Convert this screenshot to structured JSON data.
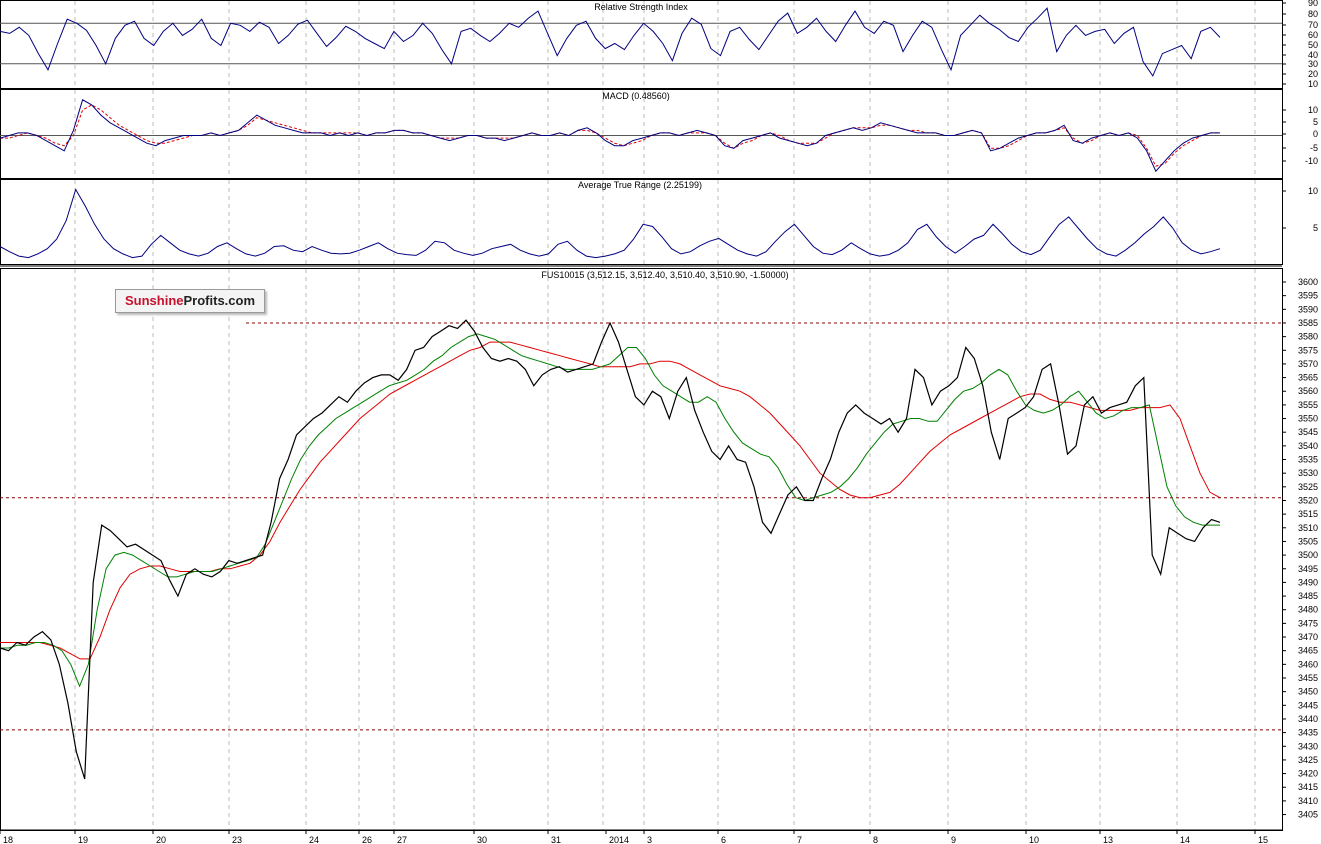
{
  "logo": {
    "part1": "Sunshine",
    "part2": "Profits.com"
  },
  "colors": {
    "price": "#000000",
    "ma_fast": "#008000",
    "ma_slow": "#e00000",
    "rsi": "#000080",
    "macd_line": "#000080",
    "macd_signal": "#e00000",
    "atr": "#000080",
    "level": "#8b0000"
  },
  "chart_data": [
    {
      "type": "line",
      "title": "Relative Strength Index",
      "ylim": [
        10,
        90
      ],
      "yticks": [
        "90",
        "80",
        "70",
        "60",
        "50",
        "40",
        "30",
        "20",
        "10"
      ],
      "reference_lines": [
        70,
        30
      ],
      "series": [
        {
          "values": [
            62,
            60,
            66,
            58,
            40,
            24,
            50,
            74,
            70,
            63,
            48,
            30,
            55,
            68,
            72,
            55,
            48,
            62,
            70,
            58,
            64,
            74,
            55,
            48,
            70,
            68,
            62,
            71,
            66,
            50,
            58,
            69,
            73,
            60,
            47,
            56,
            67,
            62,
            55,
            50,
            45,
            62,
            52,
            58,
            70,
            60,
            44,
            30,
            62,
            65,
            58,
            52,
            60,
            70,
            66,
            75,
            82,
            60,
            38,
            55,
            68,
            72,
            55,
            45,
            50,
            44,
            58,
            70,
            62,
            50,
            33,
            60,
            75,
            69,
            45,
            38,
            62,
            66,
            54,
            44,
            58,
            72,
            80,
            60,
            66,
            75,
            62,
            52,
            68,
            82,
            66,
            60,
            72,
            68,
            42,
            58,
            72,
            66,
            44,
            24,
            58,
            68,
            78,
            70,
            64,
            56,
            52,
            66,
            75,
            85,
            42,
            58,
            68,
            58,
            62,
            64,
            50,
            60,
            66,
            32,
            18,
            40,
            44,
            48,
            35,
            62,
            66,
            56
          ]
        }
      ]
    },
    {
      "type": "line",
      "title": "MACD (0.48560)",
      "ylim": [
        -16,
        16
      ],
      "yticks": [
        "10",
        "5",
        "0",
        "-5",
        "-10"
      ],
      "reference_lines": [
        0
      ],
      "series": [
        {
          "values": [
            -1,
            0,
            1,
            1,
            0,
            -2,
            -4,
            -6,
            2,
            14,
            12,
            8,
            5,
            3,
            1,
            -1,
            -3,
            -4,
            -2,
            -1,
            0,
            0,
            0,
            1,
            0,
            1,
            2,
            5,
            8,
            6,
            4,
            3,
            2,
            1,
            1,
            1,
            0,
            1,
            0,
            1,
            0,
            1,
            1,
            2,
            2,
            1,
            1,
            0,
            -1,
            -2,
            -1,
            0,
            0,
            -1,
            -1,
            -2,
            -1,
            0,
            1,
            0,
            0,
            1,
            0,
            2,
            3,
            1,
            -2,
            -4,
            -4,
            -2,
            -1,
            0,
            1,
            1,
            0,
            1,
            2,
            1,
            0,
            -4,
            -5,
            -2,
            -1,
            0,
            1,
            -1,
            -2,
            -3,
            -4,
            -3,
            0,
            1,
            2,
            3,
            2,
            3,
            5,
            4,
            3,
            2,
            1,
            1,
            1,
            0,
            0,
            1,
            2,
            1,
            -6,
            -5,
            -3,
            -1,
            0,
            1,
            1,
            2,
            4,
            -2,
            -3,
            -1,
            0,
            1,
            0,
            1,
            -1,
            -6,
            -14,
            -10,
            -6,
            -3,
            -1,
            0,
            1,
            1
          ]
        },
        {
          "values": [
            -1,
            -1,
            0,
            1,
            0,
            -1,
            -3,
            -4,
            0,
            10,
            12,
            10,
            7,
            4,
            2,
            0,
            -2,
            -3,
            -3,
            -2,
            -1,
            0,
            0,
            1,
            0,
            1,
            2,
            4,
            7,
            6,
            5,
            4,
            3,
            2,
            1,
            1,
            1,
            1,
            1,
            1,
            0,
            1,
            1,
            2,
            2,
            1,
            1,
            0,
            -1,
            -1,
            -1,
            0,
            0,
            -1,
            -1,
            -1,
            -1,
            0,
            1,
            0,
            0,
            1,
            0,
            2,
            2,
            1,
            -1,
            -3,
            -4,
            -3,
            -2,
            0,
            1,
            1,
            0,
            1,
            1,
            1,
            0,
            -3,
            -5,
            -3,
            -2,
            0,
            1,
            0,
            -2,
            -3,
            -3,
            -3,
            -1,
            1,
            2,
            3,
            3,
            3,
            4,
            4,
            3,
            2,
            2,
            1,
            1,
            0,
            0,
            1,
            2,
            1,
            -5,
            -5,
            -4,
            -2,
            0,
            1,
            1,
            2,
            3,
            -1,
            -3,
            -2,
            0,
            1,
            0,
            1,
            0,
            -5,
            -12,
            -11,
            -7,
            -4,
            -2,
            0,
            1,
            1
          ]
        }
      ]
    },
    {
      "type": "line",
      "title": "Average True Range (2.25199)",
      "ylim": [
        0,
        12
      ],
      "yticks": [
        "10",
        "5"
      ],
      "series": [
        {
          "values": [
            2.5,
            1.8,
            1.2,
            1.0,
            1.5,
            2.2,
            3.5,
            6.0,
            10.2,
            8.0,
            5.5,
            3.5,
            2.2,
            1.5,
            1.0,
            1.2,
            2.8,
            4.0,
            3.0,
            2.0,
            1.5,
            1.2,
            1.6,
            2.5,
            3.0,
            2.2,
            1.5,
            1.2,
            1.6,
            2.5,
            2.6,
            2.0,
            1.8,
            2.5,
            2.0,
            1.6,
            1.5,
            1.6,
            2.0,
            2.5,
            3.0,
            2.2,
            1.6,
            1.4,
            1.3,
            2.0,
            3.2,
            3.0,
            2.0,
            1.6,
            1.3,
            1.6,
            2.2,
            2.5,
            2.8,
            2.0,
            1.5,
            1.2,
            1.5,
            2.8,
            3.2,
            2.0,
            1.2,
            1.0,
            1.2,
            1.5,
            2.0,
            3.5,
            5.5,
            5.2,
            3.8,
            2.2,
            1.5,
            1.8,
            2.6,
            3.2,
            3.6,
            2.8,
            2.0,
            1.5,
            1.2,
            1.8,
            3.2,
            4.5,
            5.5,
            4.0,
            2.5,
            1.6,
            1.4,
            2.0,
            3.0,
            2.2,
            1.5,
            1.2,
            1.4,
            2.0,
            3.0,
            4.8,
            5.5,
            3.8,
            2.5,
            1.6,
            2.5,
            3.5,
            4.0,
            5.5,
            4.2,
            2.8,
            1.8,
            1.4,
            2.0,
            3.8,
            5.5,
            6.5,
            5.0,
            3.5,
            2.2,
            1.5,
            1.2,
            2.0,
            3.0,
            4.2,
            5.2,
            6.5,
            5.0,
            3.0,
            2.0,
            1.5,
            1.8,
            2.2
          ]
        }
      ]
    },
    {
      "type": "line",
      "title": "FUS10015 (3,512.15, 3,512.40, 3,510.40, 3,510.90, -1.50000)",
      "ylim": [
        3400,
        3603
      ],
      "yticks": [
        "3600",
        "3595",
        "3590",
        "3585",
        "3580",
        "3575",
        "3570",
        "3565",
        "3560",
        "3555",
        "3550",
        "3545",
        "3540",
        "3535",
        "3530",
        "3525",
        "3520",
        "3515",
        "3510",
        "3505",
        "3500",
        "3495",
        "3490",
        "3485",
        "3480",
        "3475",
        "3470",
        "3465",
        "3460",
        "3455",
        "3450",
        "3445",
        "3440",
        "3435",
        "3430",
        "3425",
        "3420",
        "3415",
        "3410",
        "3405"
      ],
      "x_tick_labels": [
        "18",
        "19",
        "20",
        "23",
        "24",
        "26",
        "27",
        "30",
        "31",
        "2014",
        "3",
        "6",
        "7",
        "8",
        "9",
        "10",
        "13",
        "14",
        "15"
      ],
      "reference_lines": [
        3585,
        3521,
        3436
      ],
      "series": [
        {
          "values": [
            3466,
            3465,
            3468,
            3467,
            3470,
            3472,
            3469,
            3460,
            3446,
            3428,
            3418,
            3490,
            3511,
            3509,
            3506,
            3503,
            3504,
            3502,
            3500,
            3498,
            3491,
            3485,
            3493,
            3495,
            3493,
            3492,
            3494,
            3498,
            3497,
            3498,
            3499,
            3500,
            3512,
            3528,
            3535,
            3544,
            3547,
            3550,
            3552,
            3555,
            3558,
            3556,
            3560,
            3563,
            3565,
            3566,
            3566,
            3564,
            3568,
            3575,
            3576,
            3580,
            3582,
            3584,
            3583,
            3586,
            3582,
            3576,
            3572,
            3571,
            3572,
            3571,
            3568,
            3562,
            3566,
            3568,
            3569,
            3567,
            3568,
            3569,
            3570,
            3578,
            3585,
            3578,
            3568,
            3558,
            3555,
            3560,
            3558,
            3550,
            3560,
            3565,
            3553,
            3545,
            3538,
            3535,
            3540,
            3535,
            3534,
            3525,
            3512,
            3508,
            3515,
            3522,
            3525,
            3520,
            3520,
            3528,
            3535,
            3545,
            3552,
            3555,
            3552,
            3550,
            3548,
            3550,
            3545,
            3550,
            3568,
            3565,
            3555,
            3560,
            3562,
            3565,
            3576,
            3572,
            3562,
            3545,
            3535,
            3550,
            3552,
            3554,
            3558,
            3568,
            3570,
            3555,
            3537,
            3540,
            3555,
            3558,
            3552,
            3554,
            3555,
            3556,
            3562,
            3565,
            3500,
            3493,
            3510,
            3508,
            3506,
            3505,
            3510,
            3513,
            3512
          ]
        },
        {
          "values": [
            3466,
            3466,
            3467,
            3467,
            3468,
            3468,
            3467,
            3465,
            3460,
            3452,
            3460,
            3480,
            3495,
            3500,
            3501,
            3500,
            3498,
            3496,
            3494,
            3492,
            3492,
            3493,
            3494,
            3494,
            3494,
            3495,
            3496,
            3497,
            3498,
            3499,
            3504,
            3512,
            3520,
            3528,
            3535,
            3540,
            3544,
            3547,
            3550,
            3552,
            3554,
            3556,
            3558,
            3560,
            3562,
            3563,
            3564,
            3566,
            3568,
            3571,
            3573,
            3576,
            3578,
            3580,
            3581,
            3580,
            3579,
            3577,
            3575,
            3573,
            3572,
            3571,
            3570,
            3569,
            3568,
            3568,
            3568,
            3568,
            3569,
            3570,
            3573,
            3576,
            3576,
            3572,
            3566,
            3562,
            3560,
            3558,
            3556,
            3556,
            3558,
            3556,
            3550,
            3545,
            3541,
            3539,
            3537,
            3536,
            3532,
            3526,
            3521,
            3520,
            3521,
            3522,
            3523,
            3525,
            3528,
            3532,
            3537,
            3541,
            3545,
            3548,
            3549,
            3550,
            3550,
            3549,
            3549,
            3553,
            3557,
            3560,
            3561,
            3563,
            3566,
            3568,
            3566,
            3560,
            3555,
            3553,
            3552,
            3553,
            3555,
            3558,
            3560,
            3556,
            3552,
            3550,
            3551,
            3553,
            3554,
            3554,
            3555,
            3540,
            3525,
            3518,
            3514,
            3512,
            3511,
            3511,
            3511
          ]
        },
        {
          "values": [
            3468,
            3468,
            3468,
            3468,
            3468,
            3467,
            3466,
            3464,
            3462,
            3462,
            3470,
            3480,
            3488,
            3493,
            3495,
            3496,
            3496,
            3495,
            3494,
            3494,
            3494,
            3494,
            3495,
            3495,
            3496,
            3497,
            3500,
            3505,
            3512,
            3518,
            3524,
            3529,
            3534,
            3538,
            3542,
            3546,
            3550,
            3553,
            3556,
            3559,
            3561,
            3563,
            3565,
            3567,
            3569,
            3571,
            3573,
            3575,
            3576,
            3578,
            3578,
            3578,
            3577,
            3576,
            3575,
            3574,
            3573,
            3572,
            3571,
            3570,
            3569,
            3569,
            3569,
            3569,
            3570,
            3570,
            3571,
            3571,
            3570,
            3568,
            3566,
            3564,
            3562,
            3561,
            3560,
            3558,
            3555,
            3552,
            3548,
            3544,
            3540,
            3535,
            3530,
            3527,
            3524,
            3522,
            3521,
            3521,
            3522,
            3523,
            3526,
            3530,
            3534,
            3538,
            3541,
            3544,
            3546,
            3548,
            3550,
            3552,
            3554,
            3556,
            3558,
            3559,
            3559,
            3557,
            3556,
            3556,
            3555,
            3554,
            3553,
            3553,
            3553,
            3553,
            3554,
            3554,
            3554,
            3555,
            3550,
            3540,
            3530,
            3523,
            3521
          ]
        }
      ]
    }
  ]
}
